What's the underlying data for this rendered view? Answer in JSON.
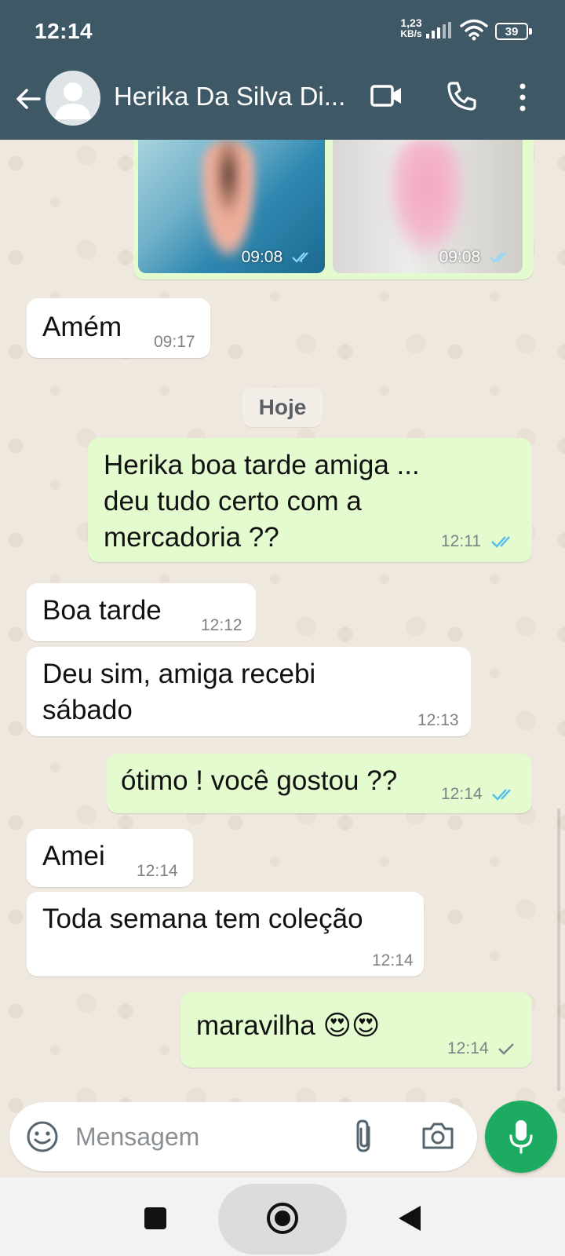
{
  "status_bar": {
    "time": "12:14",
    "speed_value": "1,23",
    "speed_unit": "KB/s",
    "battery": "39",
    "icons": [
      "signal-icon",
      "wifi-icon",
      "battery-icon"
    ]
  },
  "header": {
    "contact_name": "Herika Da Silva Di...",
    "icons": [
      "back-arrow-icon",
      "avatar-icon",
      "video-call-icon",
      "phone-call-icon",
      "more-options-icon"
    ]
  },
  "media": [
    {
      "time": "09:08",
      "status": "read"
    },
    {
      "time": "09:08",
      "status": "read"
    }
  ],
  "date_separator": "Hoje",
  "messages": [
    {
      "direction": "in",
      "text": "Amém",
      "time": "09:17"
    },
    {
      "direction": "out",
      "lines": [
        "Herika boa tarde amiga ...",
        "deu tudo certo com a",
        "mercadoria ??"
      ],
      "time": "12:11",
      "status": "read"
    },
    {
      "direction": "in",
      "text": "Boa tarde",
      "time": "12:12"
    },
    {
      "direction": "in",
      "lines": [
        "Deu sim, amiga recebi",
        "sábado"
      ],
      "time": "12:13"
    },
    {
      "direction": "out",
      "text": "ótimo ! você gostou ??",
      "time": "12:14",
      "status": "read"
    },
    {
      "direction": "in",
      "text": "Amei",
      "time": "12:14"
    },
    {
      "direction": "in",
      "text": "Toda semana tem coleção",
      "time": "12:14"
    },
    {
      "direction": "out",
      "text": "maravilha 😍😍",
      "time": "12:14",
      "status": "sent"
    }
  ],
  "composer": {
    "placeholder": "Mensagem",
    "value": "",
    "icons": [
      "emoji-icon",
      "attach-icon",
      "camera-icon",
      "mic-icon"
    ]
  },
  "colors": {
    "header": "#3e5866",
    "outgoing_bubble": "#e3fbcf",
    "incoming_bubble": "#ffffff",
    "read_tick": "#53bdeb",
    "mic_button": "#1daa61",
    "chat_background": "#efe8df"
  }
}
